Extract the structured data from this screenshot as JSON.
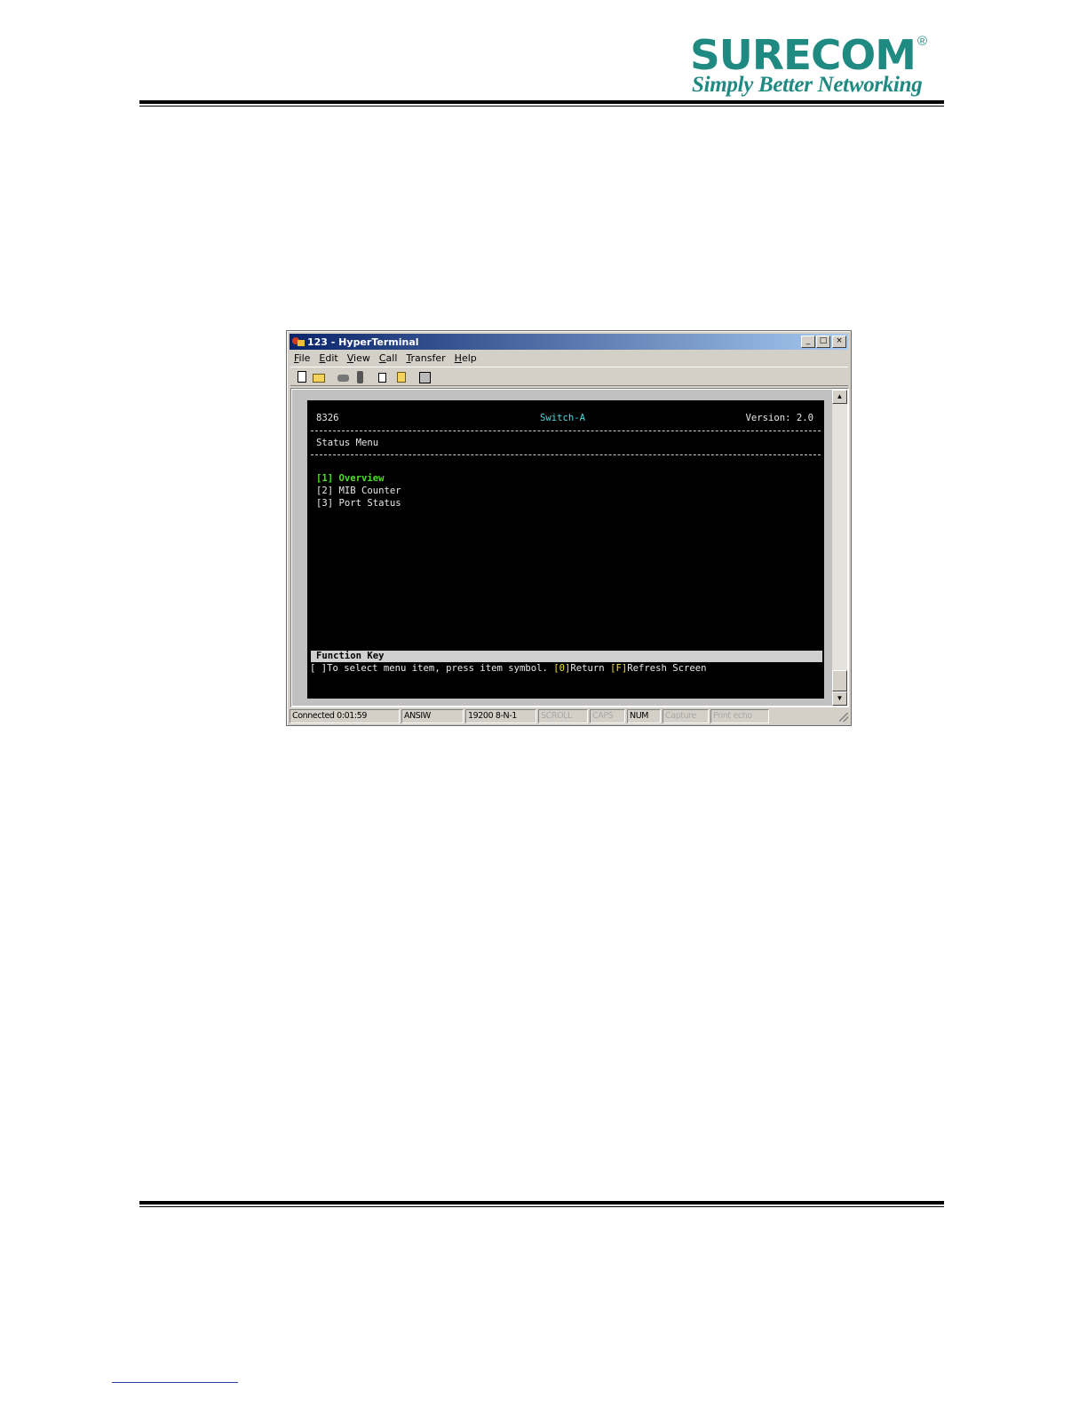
{
  "page": {
    "logo": {
      "wordmark": "SURECOM",
      "registered": "®",
      "tagline": "Simply Better Networking"
    }
  },
  "window": {
    "title": "123 - HyperTerminal",
    "caption_buttons": {
      "minimize": "_",
      "maximize": "□",
      "close": "×"
    },
    "menu": [
      "File",
      "Edit",
      "View",
      "Call",
      "Transfer",
      "Help"
    ],
    "toolbar_icons": [
      "new-icon",
      "open-icon",
      "connect-icon",
      "disconnect-icon",
      "send-icon",
      "receive-icon",
      "properties-icon"
    ],
    "terminal": {
      "model": "8326",
      "device_name": "Switch-A",
      "version": "Version: 2.0",
      "menu_title": "Status Menu",
      "items": [
        {
          "key": "[1]",
          "label": "Overview"
        },
        {
          "key": "[2]",
          "label": "MIB Counter"
        },
        {
          "key": "[3]",
          "label": "Port Status"
        }
      ],
      "function_key_header": "Function Key",
      "help": {
        "prefix": "[ ]To select menu item, press item symbol. ",
        "return_key": "[0]",
        "return_label": "Return ",
        "refresh_key": "[F]",
        "refresh_label": "Refresh Screen"
      }
    },
    "scroll": {
      "up": "▲",
      "down": "▼"
    },
    "status_bar": {
      "connected": "Connected 0:01:59",
      "emulation": "ANSIW",
      "port_settings": "19200 8-N-1",
      "scroll": "SCROLL",
      "caps": "CAPS",
      "num": "NUM",
      "capture": "Capture",
      "print_echo": "Print echo"
    }
  }
}
